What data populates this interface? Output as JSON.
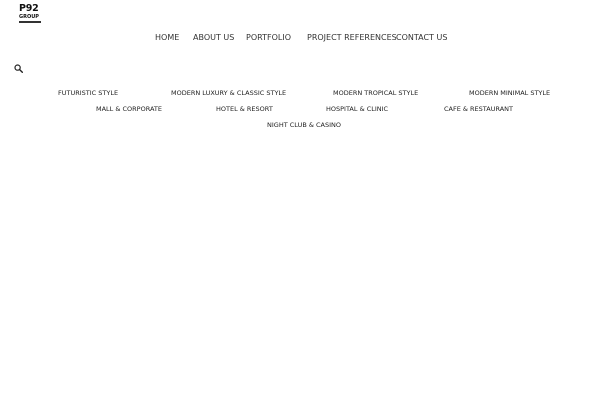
{
  "logo": {
    "main": "P92",
    "sub": "GROUP"
  },
  "nav": {
    "items": [
      "HOME",
      "ABOUT US",
      "PORTFOLIO",
      "PROJECT REFERENCES",
      "CONTACT US"
    ]
  },
  "icons": {
    "search": "search-icon"
  },
  "categories": {
    "row1": [
      "FUTURISTIC STYLE",
      "MODERN LUXURY & CLASSIC STYLE",
      "MODERN TROPICAL STYLE",
      "MODERN MINIMAL STYLE"
    ],
    "row2": [
      "MALL & CORPORATE",
      "HOTEL & RESORT",
      "HOSPITAL & CLINIC",
      "CAFE & RESTAURANT"
    ],
    "row3": [
      "NIGHT CLUB & CASINO"
    ]
  }
}
